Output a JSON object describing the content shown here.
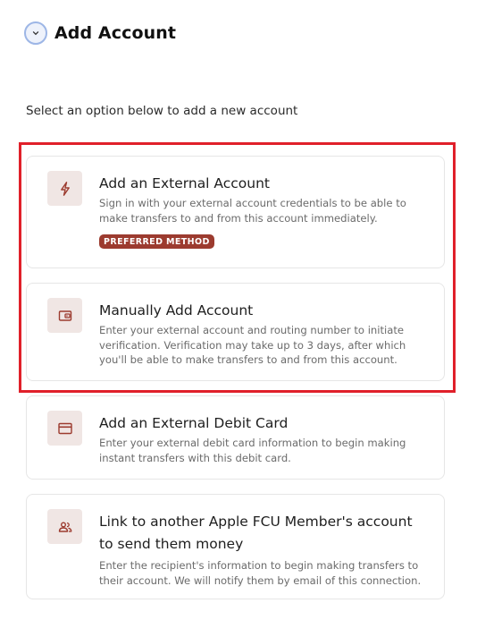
{
  "header": {
    "title": "Add Account",
    "back_icon": "chevron-down-icon"
  },
  "subtitle": "Select an option below to add a new account",
  "accent_color": "#9c3b2f",
  "highlight_color": "#e0202a",
  "options": [
    {
      "icon": "lightning-icon",
      "title": "Add an External Account",
      "description": "Sign in with your external account credentials to be able to make transfers to and from this account immediately.",
      "badge": "PREFERRED METHOD"
    },
    {
      "icon": "wallet-icon",
      "title": "Manually Add Account",
      "description": "Enter your external account and routing number to initiate verification. Verification may take up to 3 days, after which you'll be able to make transfers to and from this account."
    },
    {
      "icon": "credit-card-icon",
      "title": "Add an External Debit Card",
      "description": "Enter your external debit card information to begin making instant transfers with this debit card."
    },
    {
      "icon": "people-icon",
      "title": "Link to another Apple FCU Member's account to send them money",
      "description": "Enter the recipient's information to begin making transfers to their account. We will notify them by email of this connection."
    }
  ]
}
